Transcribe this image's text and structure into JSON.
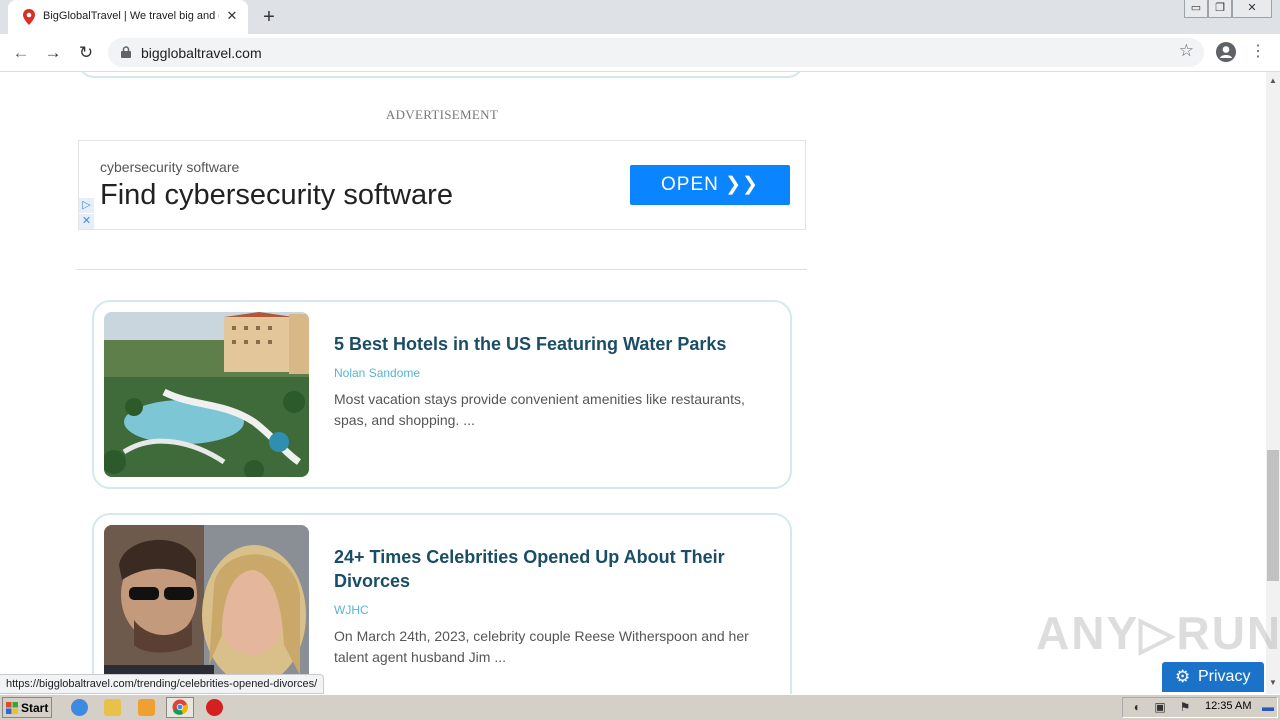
{
  "browser": {
    "tab_title": "BigGlobalTravel | We travel big and c",
    "tab_close": "✕",
    "new_tab": "+",
    "url": "bigglobaltravel.com",
    "window_controls": [
      "▭",
      "❐",
      "✕"
    ]
  },
  "ad": {
    "label": "ADVERTISEMENT",
    "small_text": "cybersecurity software",
    "headline": "Find cybersecurity software",
    "button": "OPEN ❯❯",
    "choices_icon": "▷",
    "close_icon": "✕"
  },
  "articles": [
    {
      "title": "5 Best Hotels in the US Featuring Water Parks",
      "author": "Nolan Sandome",
      "excerpt": "Most vacation stays provide convenient amenities like restaurants, spas, and shopping. ..."
    },
    {
      "title": "24+ Times Celebrities Opened Up About Their Divorces",
      "author": "WJHC",
      "excerpt": "On March 24th, 2023, celebrity couple Reese Witherspoon and her talent agent husband Jim ..."
    }
  ],
  "status_url": "https://bigglobaltravel.com/trending/celebrities-opened-divorces/",
  "privacy": {
    "label": "Privacy",
    "icon": "⚙"
  },
  "watermark": "ANY▷RUN",
  "taskbar": {
    "start": "Start",
    "clock": "12:35 AM"
  },
  "colors": {
    "accent": "#0a84ff",
    "title": "#1a4d66",
    "author": "#5ab4cf",
    "card_border": "#d5e8ec",
    "privacy": "#1a73c8"
  }
}
